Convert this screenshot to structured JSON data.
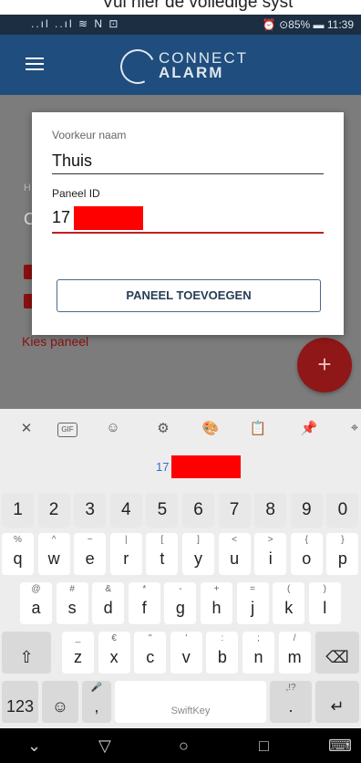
{
  "caption": "Vul hier de volledige syst",
  "status": {
    "left": "..ıl ..ıl ≋ N ⊡",
    "right": "⏰ ⊙85% ▬ 11:39"
  },
  "app": {
    "logo_line1": "CONNECT",
    "logo_line2": "ALARM"
  },
  "background": {
    "hint": "H",
    "field_letter": "C",
    "select_label": "Kies paneel",
    "fab_label": "+"
  },
  "dialog": {
    "name_label": "Voorkeur naam",
    "name_value": "Thuis",
    "id_label": "Paneel ID",
    "id_value": "17",
    "add_button": "PANEEL TOEVOEGEN"
  },
  "keyboard": {
    "suggestion": "17",
    "number_row": [
      "1",
      "2",
      "3",
      "4",
      "5",
      "6",
      "7",
      "8",
      "9",
      "0"
    ],
    "row1": [
      {
        "k": "q",
        "s": "%"
      },
      {
        "k": "w",
        "s": "^"
      },
      {
        "k": "e",
        "s": "~"
      },
      {
        "k": "r",
        "s": "|"
      },
      {
        "k": "t",
        "s": "["
      },
      {
        "k": "y",
        "s": "]"
      },
      {
        "k": "u",
        "s": "<"
      },
      {
        "k": "i",
        "s": ">"
      },
      {
        "k": "o",
        "s": "{"
      },
      {
        "k": "p",
        "s": "}"
      }
    ],
    "row2": [
      {
        "k": "a",
        "s": "@"
      },
      {
        "k": "s",
        "s": "#"
      },
      {
        "k": "d",
        "s": "&"
      },
      {
        "k": "f",
        "s": "*"
      },
      {
        "k": "g",
        "s": "-"
      },
      {
        "k": "h",
        "s": "+"
      },
      {
        "k": "j",
        "s": "="
      },
      {
        "k": "k",
        "s": "("
      },
      {
        "k": "l",
        "s": ")"
      }
    ],
    "row3": [
      {
        "k": "z",
        "s": "_"
      },
      {
        "k": "x",
        "s": "€"
      },
      {
        "k": "c",
        "s": "\""
      },
      {
        "k": "v",
        "s": "'"
      },
      {
        "k": "b",
        "s": ":"
      },
      {
        "k": "n",
        "s": ";"
      },
      {
        "k": "m",
        "s": "/"
      }
    ],
    "sym_key": "123",
    "comma_key": ",",
    "space_label": "SwiftKey",
    "period_key": ".",
    "period_sub": ",!?"
  },
  "colors": {
    "appbar": "#1f4d7d",
    "accent_red": "#c02020",
    "fab": "#8f1717"
  }
}
